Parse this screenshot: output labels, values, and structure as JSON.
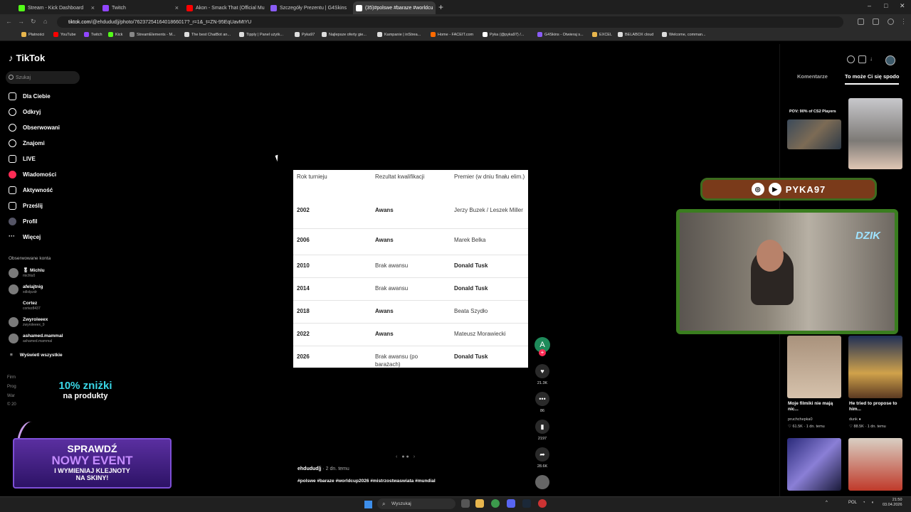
{
  "browser": {
    "tabs": [
      {
        "label": "Stream - Kick Dashboard",
        "color": "#53fc18"
      },
      {
        "label": "Twitch",
        "color": "#9146ff"
      },
      {
        "label": "Akon - Smack That (Official Mu",
        "color": "#ff0000"
      },
      {
        "label": "Szczegóły Prezentu | G4Skins",
        "color": "#8a5cf6"
      },
      {
        "label": "(35)#polswe #baraze #worldcu",
        "color": "#ffffff"
      }
    ],
    "url_domain": "tiktok.com",
    "url_path": "/@ehdudud|j/photo/7623725416401866017?_r=1&_t=ZN-95EqUavMtYU",
    "bookmarks": [
      "Płatności",
      "YouTube",
      "Twitch",
      "Kick",
      "StreamElements - M...",
      "The best ChatBot an...",
      "Tipply | Panel użytk...",
      "Pyka97",
      "Najlepsze oferty gie...",
      "Kampanie | inStrea...",
      "Home - FACEIT.com",
      "Pyka (@pyka97) /...",
      "G4Skins - Otwieraj s...",
      "EXCEL",
      "BELABOX cloud",
      "Welcome, comman..."
    ]
  },
  "tiktok": {
    "logo": "TikTok",
    "search_placeholder": "Szukaj",
    "nav": [
      "Dla Ciebie",
      "Odkryj",
      "Obserwowani",
      "Znajomi",
      "LIVE",
      "Wiadomości",
      "Aktywność",
      "Prześlij",
      "Profil",
      "Więcej"
    ],
    "followed_heading": "Obserwowane konta",
    "accounts": [
      {
        "name": "🎖 Michlu",
        "handle": "michlu0"
      },
      {
        "name": "afelajtnig",
        "handle": "xdlolpzdr"
      },
      {
        "name": "Cortez",
        "handle": "cortez8437"
      },
      {
        "name": "Zwyroleeex",
        "handle": "zwyroleeex_9"
      },
      {
        "name": "ashamed.mammal",
        "handle": "ashamed.mammal"
      }
    ],
    "see_all": "Wyświetl wszystkie",
    "footer": [
      "Firm",
      "Prog",
      "War",
      "© 20"
    ]
  },
  "promo": {
    "line1": "10% zniżki",
    "line2": "na produkty",
    "event1": "SPRAWDŹ",
    "event2": "NOWY EVENT",
    "event3": "I WYMIENIAJ KLEJNOTY",
    "event4": "NA SKINY!"
  },
  "post": {
    "headers": [
      "Rok turnieju",
      "Rezultat kwalifikacji",
      "Premier (w dniu finału elim.)"
    ],
    "rows": [
      {
        "year": "2002",
        "result": "Awans",
        "pm": "Jerzy Buzek / Leszek Miller",
        "result_bold": true,
        "pm_bold": false
      },
      {
        "year": "2006",
        "result": "Awans",
        "pm": "Marek Belka",
        "result_bold": true,
        "pm_bold": false
      },
      {
        "year": "2010",
        "result": "Brak awansu",
        "pm": "Donald Tusk",
        "result_bold": false,
        "pm_bold": true
      },
      {
        "year": "2014",
        "result": "Brak awansu",
        "pm": "Donald Tusk",
        "result_bold": false,
        "pm_bold": true
      },
      {
        "year": "2018",
        "result": "Awans",
        "pm": "Beata Szydło",
        "result_bold": true,
        "pm_bold": false
      },
      {
        "year": "2022",
        "result": "Awans",
        "pm": "Mateusz Morawiecki",
        "result_bold": true,
        "pm_bold": false
      },
      {
        "year": "2026",
        "result": "Brak awansu (po barażach)",
        "pm": "Donald Tusk",
        "result_bold": false,
        "pm_bold": true
      }
    ],
    "author": "ehdudud|j",
    "ago": "· 2 dn. temu",
    "tags": "#polswe #baraze #worldcup2026 #mistrzostwaswiata #mundial",
    "likes": "21.3K",
    "comments": "86",
    "saves": "2197",
    "shares": "28.6K",
    "avatar_letter": "A"
  },
  "right": {
    "tab_comments": "Komentarze",
    "tab_suggested": "To może Ci się spodo",
    "thumb_top_caption": "POV: 90% of CS2 Players",
    "videos": [
      {
        "title": "Moje filmiki nie mają nic...",
        "user": "pruchchepka0",
        "stats": "♡ 61.5K · 1 dn. temu"
      },
      {
        "title": "He tried to propose to him...",
        "user": "dunk ●",
        "stats": "♡ 88.5K · 1 dn. temu"
      }
    ]
  },
  "overlay": {
    "handle": "PYKA97",
    "sign": "DZIK"
  },
  "taskbar": {
    "search": "Wyszukaj",
    "lang": "POL",
    "time": "21:50",
    "date": "03.04.2026"
  }
}
